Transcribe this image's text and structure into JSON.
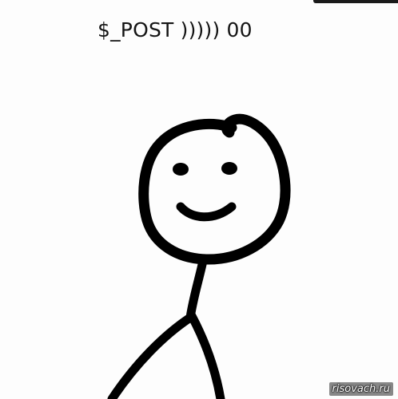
{
  "caption": {
    "text": "$_POST ))))) 00"
  },
  "drawing": {
    "subject": "stick-figure-smiling",
    "line_color": "#000000",
    "background_color": "#fdfdfd"
  },
  "watermark": {
    "text": "risovach.ru"
  }
}
